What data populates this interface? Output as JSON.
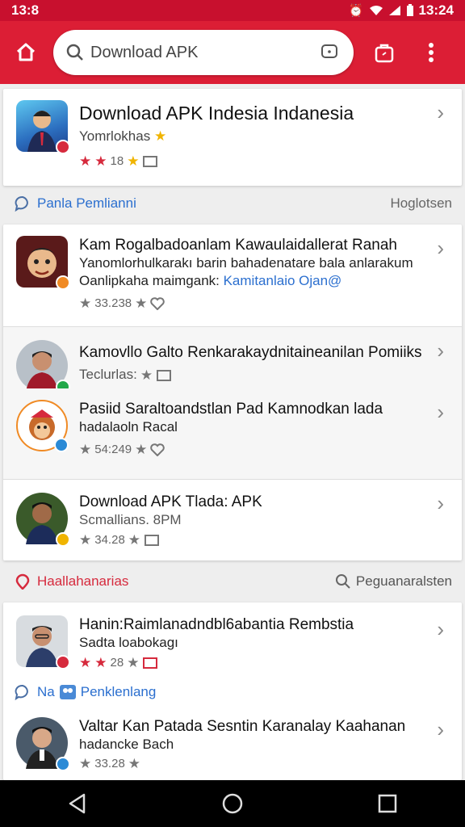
{
  "status": {
    "time_left": "13:8",
    "time_right": "13:24"
  },
  "search": {
    "value": "Download APK",
    "placeholder": "Download APK"
  },
  "top_card": {
    "title": "Download APK Indesia Indanesia",
    "subtitle": "Yomrlokhas",
    "rating_text": "18",
    "emoji": "★"
  },
  "section1": {
    "label": "Panla Pemlianni",
    "right": "Hoglotsen"
  },
  "list1": [
    {
      "title": "Kam Rogalbadoanlam Kawaulaidallerat Ranah",
      "line2": "Yanomlorhulkarakı barin bahadenatare bala anlarakum",
      "line3_plain": "Oanlipkaha maimgank: ",
      "line3_link": "Kamitanlaio Ojan@",
      "rating": "33.238"
    },
    {
      "title": "Kamovllo Galto Renkarakaydnitaineanilan Pomiiks",
      "sub": "Teclurlas:",
      "rating": ""
    },
    {
      "title": "Pasiid Saraltoandstlan Pad Kamnodkan lada",
      "sub": "hadalaoln Racal",
      "rating": "54:249"
    },
    {
      "title": "Download APK Tlada: APK",
      "sub": "Scmallians. 8PM",
      "rating": "34.28"
    }
  ],
  "section2": {
    "label": "Haallahanarias",
    "right": "Peguanaralsten"
  },
  "list2": [
    {
      "title": "Hanin:Raimlanadndbl6abantia Rembstia",
      "sub": "Sadta loabokagı",
      "rating": "28"
    },
    {
      "subsection": "Na",
      "subsection_label": "Penklenlang"
    },
    {
      "title": "Valtar Kan Patada Sesntin Karanalay Kaahanan",
      "sub": "hadancke Bach",
      "rating": "33.28"
    }
  ],
  "colors": {
    "brand": "#dc1e35",
    "status": "#c8102e",
    "link": "#2b6fcf"
  }
}
